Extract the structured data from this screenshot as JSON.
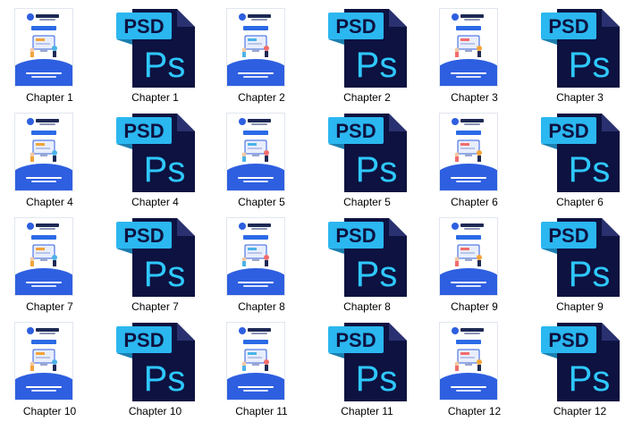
{
  "window": {
    "title": ""
  },
  "items": [
    {
      "label": "Chapter 1",
      "type": "ebook"
    },
    {
      "label": "Chapter 1",
      "type": "psd"
    },
    {
      "label": "Chapter 2",
      "type": "ebook"
    },
    {
      "label": "Chapter 2",
      "type": "psd"
    },
    {
      "label": "Chapter 3",
      "type": "ebook"
    },
    {
      "label": "Chapter 3",
      "type": "psd"
    },
    {
      "label": "Chapter 4",
      "type": "ebook"
    },
    {
      "label": "Chapter 4",
      "type": "psd"
    },
    {
      "label": "Chapter 5",
      "type": "ebook"
    },
    {
      "label": "Chapter 5",
      "type": "psd"
    },
    {
      "label": "Chapter 6",
      "type": "ebook"
    },
    {
      "label": "Chapter 6",
      "type": "psd"
    },
    {
      "label": "Chapter 7",
      "type": "ebook"
    },
    {
      "label": "Chapter 7",
      "type": "psd"
    },
    {
      "label": "Chapter 8",
      "type": "ebook"
    },
    {
      "label": "Chapter 8",
      "type": "psd"
    },
    {
      "label": "Chapter 9",
      "type": "ebook"
    },
    {
      "label": "Chapter 9",
      "type": "psd"
    },
    {
      "label": "Chapter 10",
      "type": "ebook"
    },
    {
      "label": "Chapter 10",
      "type": "psd"
    },
    {
      "label": "Chapter 11",
      "type": "ebook"
    },
    {
      "label": "Chapter 11",
      "type": "psd"
    },
    {
      "label": "Chapter 12",
      "type": "ebook"
    },
    {
      "label": "Chapter 12",
      "type": "psd"
    }
  ],
  "psd_icon": {
    "badge_text": "PSD",
    "mark_text": "Ps",
    "badge_color": "#2bb7f0",
    "body_color": "#0d1240",
    "fold_color": "#2a3170",
    "mark_color": "#2ec8ff"
  },
  "ebook_icon": {
    "accent": "#2e5fe0",
    "accent_dark": "#1f47c4",
    "logo_text": "Google Classroom"
  },
  "colors": {
    "background": "#ffffff",
    "label": "#000000"
  }
}
